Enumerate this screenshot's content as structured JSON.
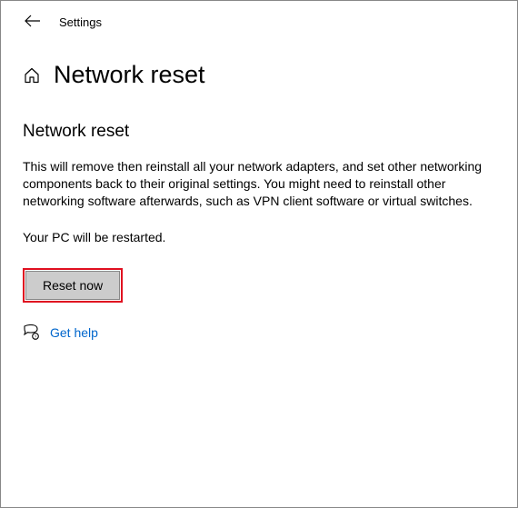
{
  "header": {
    "app_title": "Settings"
  },
  "page": {
    "title": "Network reset"
  },
  "content": {
    "heading": "Network reset",
    "description": "This will remove then reinstall all your network adapters, and set other networking components back to their original settings. You might need to reinstall other networking software afterwards, such as VPN client software or virtual switches.",
    "restart_note": "Your PC will be restarted.",
    "reset_button_label": "Reset now",
    "help_link_label": "Get help"
  }
}
